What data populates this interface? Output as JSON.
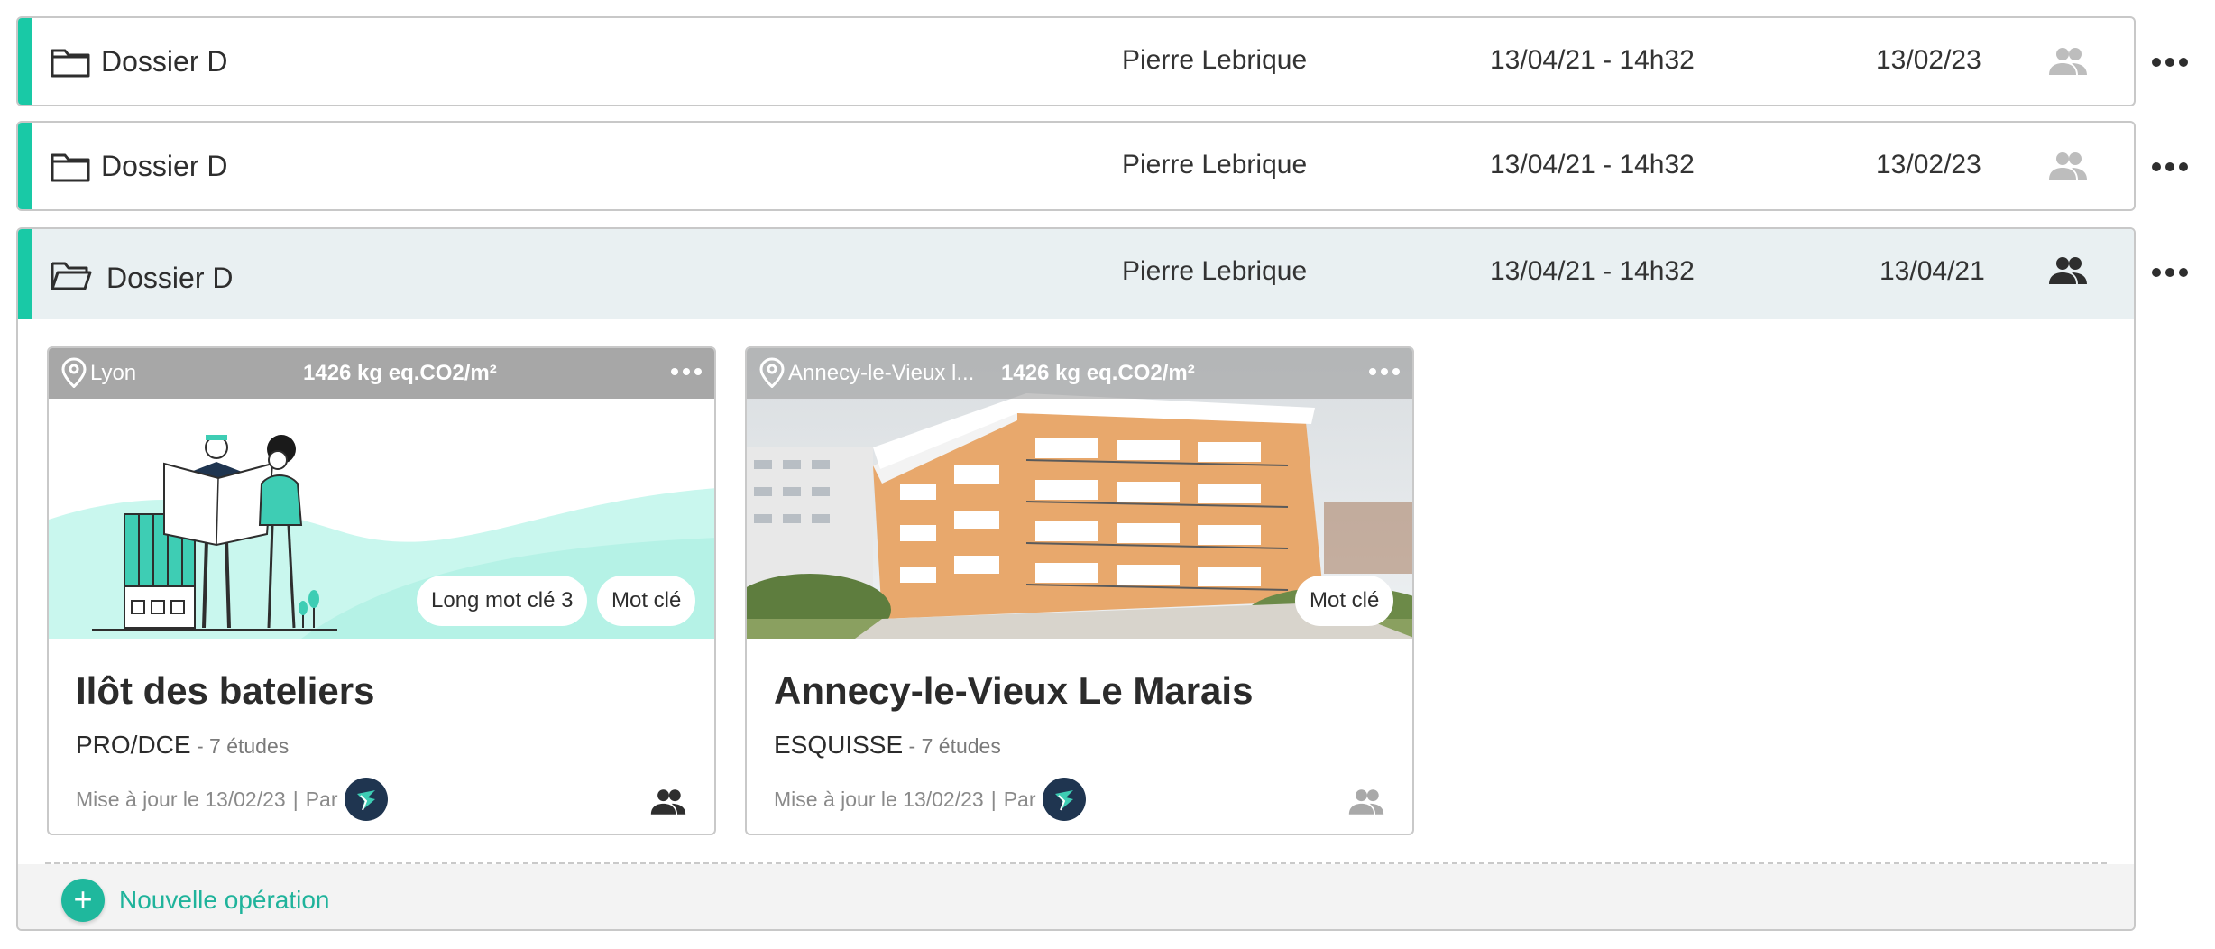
{
  "colors": {
    "accent": "#19c9a6",
    "open_header_bg": "#e9f0f2",
    "add_button": "#1fb89d",
    "muted_people": "#bdbdbd"
  },
  "folders": [
    {
      "name": "Dossier D",
      "owner": "Pierre Lebrique",
      "created": "13/04/21 - 14h32",
      "updated": "13/02/23",
      "icon": "folder-icon",
      "shared_icon": "people-icon-muted"
    },
    {
      "name": "Dossier D",
      "owner": "Pierre Lebrique",
      "created": "13/04/21 - 14h32",
      "updated": "13/02/23",
      "icon": "folder-icon",
      "shared_icon": "people-icon-muted"
    },
    {
      "name": "Dossier D",
      "owner": "Pierre Lebrique",
      "created": "13/04/21 - 14h32",
      "updated": "13/04/21",
      "icon": "folder-open-icon",
      "shared_icon": "people-icon"
    }
  ],
  "cards": [
    {
      "location": "Lyon",
      "co2": "1426 kg eq.CO2/m²",
      "tags": [
        "Long mot clé 3",
        "Mot clé"
      ],
      "title": "Ilôt des bateliers",
      "phase": "PRO/DCE",
      "studies": " - 7 études",
      "updated": "Mise à jour le 13/02/23",
      "by": "Par",
      "image": "illustration-two-people-reading-plan"
    },
    {
      "location": "Annecy-le-Vieux l...",
      "co2": "1426 kg eq.CO2/m²",
      "tags": [
        "Mot clé"
      ],
      "title": "Annecy-le-Vieux Le Marais",
      "phase": "ESQUISSE",
      "studies": " - 7 études",
      "updated": "Mise à jour le 13/02/23",
      "by": "Par",
      "image": "photo-apartment-building"
    }
  ],
  "add_operation": {
    "icon": "+",
    "label": "Nouvelle opération"
  }
}
